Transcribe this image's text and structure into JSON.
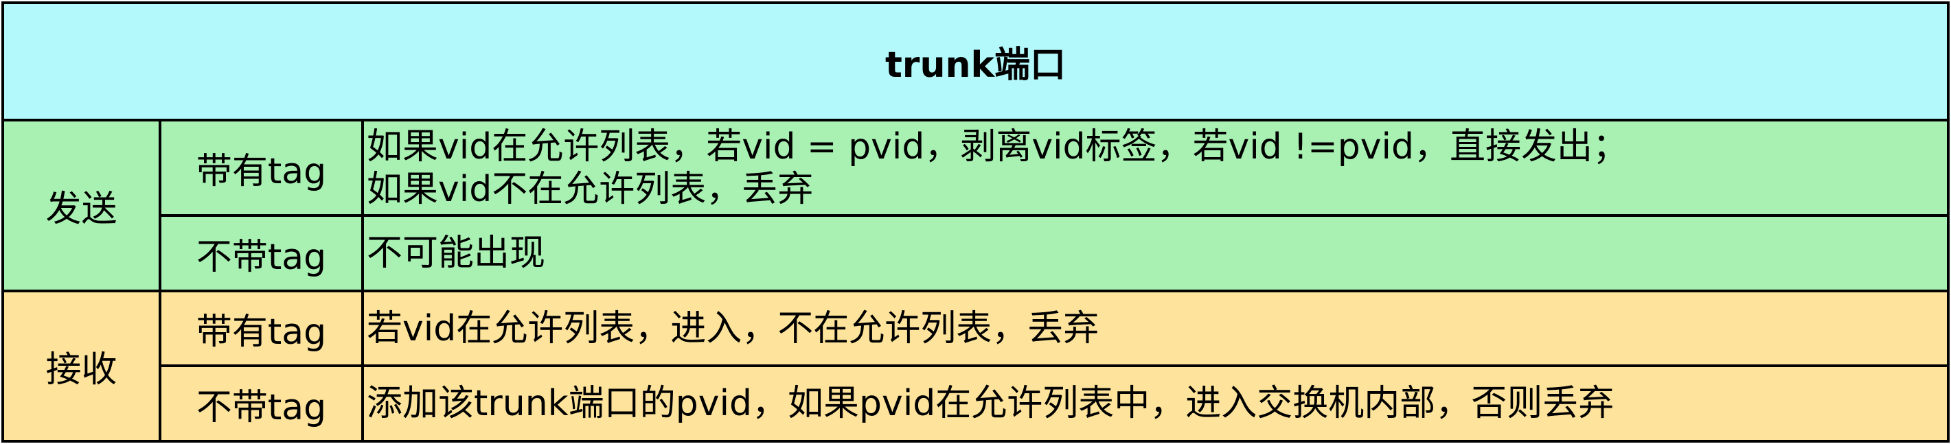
{
  "table": {
    "title": "trunk端口",
    "colors": {
      "title_bg": "#b3f9fb",
      "send_bg": "#a8f1b2",
      "receive_bg": "#fde39b",
      "border": "#000000"
    },
    "send": {
      "label": "发送",
      "tagged": {
        "label": "带有tag",
        "line1": "如果vid在允许列表，若vid = pvid，剥离vid标签，若vid !=pvid，直接发出；",
        "line2": "如果vid不在允许列表，丢弃"
      },
      "untagged": {
        "label": "不带tag",
        "text": "不可能出现"
      }
    },
    "receive": {
      "label": "接收",
      "tagged": {
        "label": "带有tag",
        "text": "若vid在允许列表，进入，不在允许列表，丢弃"
      },
      "untagged": {
        "label": "不带tag",
        "text": "添加该trunk端口的pvid，如果pvid在允许列表中，进入交换机内部，否则丢弃"
      }
    }
  }
}
